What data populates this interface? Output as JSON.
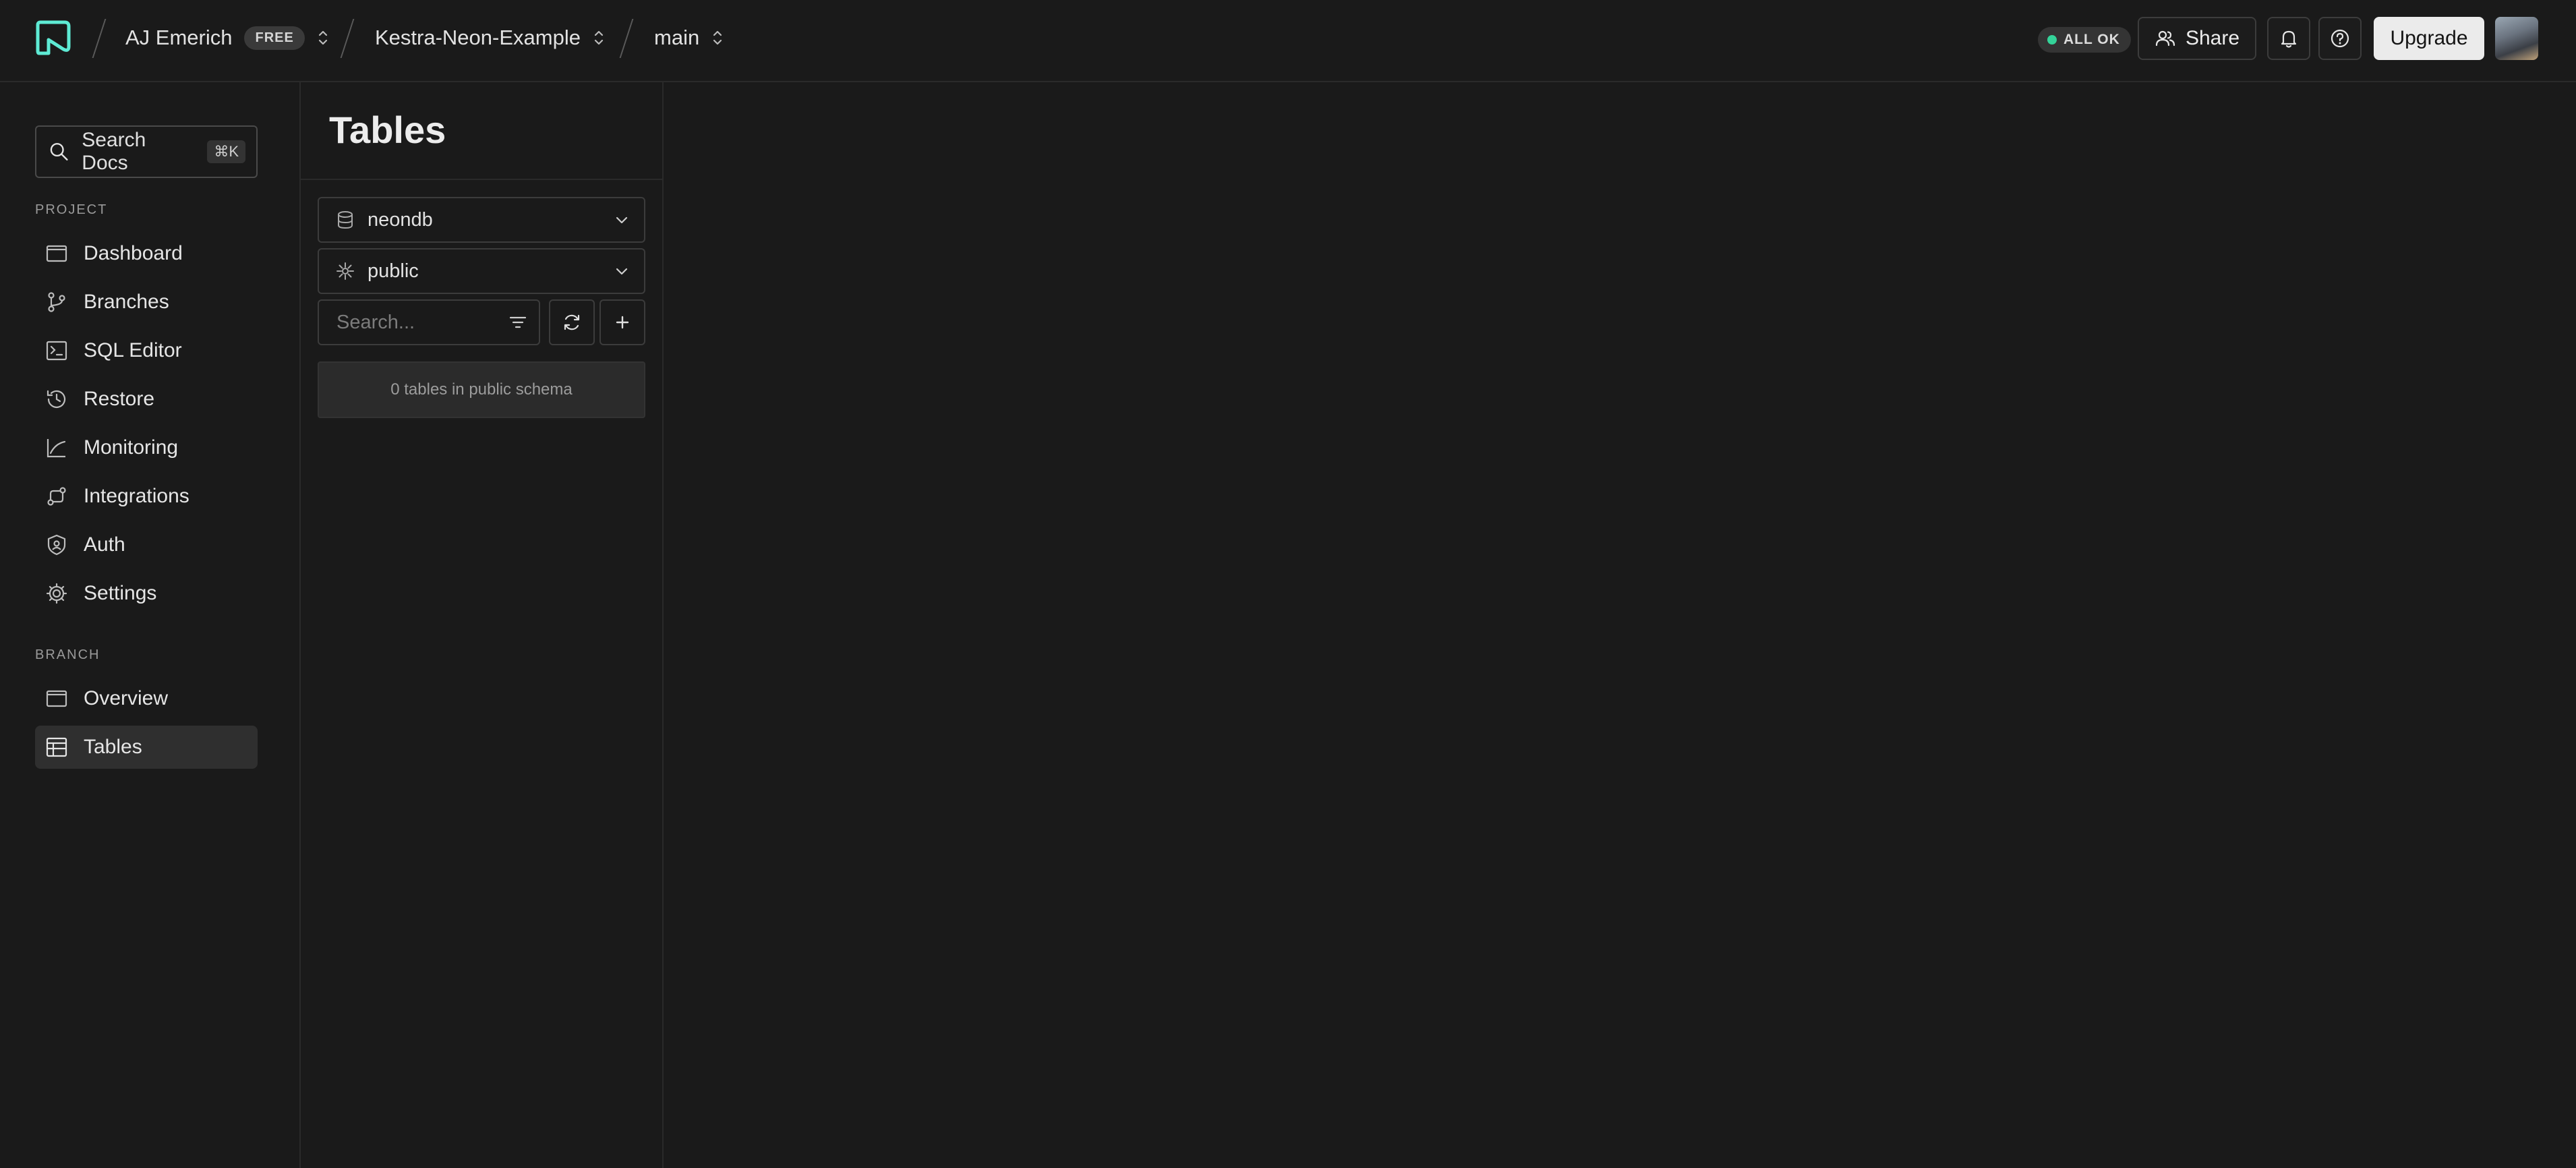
{
  "header": {
    "org_name": "AJ Emerich",
    "plan_badge": "FREE",
    "project_name": "Kestra-Neon-Example",
    "branch_name": "main",
    "status_text": "ALL OK",
    "share_label": "Share",
    "upgrade_label": "Upgrade",
    "status_color": "#34d399",
    "logo_color": "#5eead4"
  },
  "sidebar": {
    "search_label": "Search Docs",
    "search_shortcut": "⌘K",
    "project_section": "PROJECT",
    "project_items": [
      {
        "label": "Dashboard",
        "icon": "dashboard-icon"
      },
      {
        "label": "Branches",
        "icon": "branches-icon"
      },
      {
        "label": "SQL Editor",
        "icon": "sql-editor-icon"
      },
      {
        "label": "Restore",
        "icon": "restore-icon"
      },
      {
        "label": "Monitoring",
        "icon": "monitoring-icon"
      },
      {
        "label": "Integrations",
        "icon": "integrations-icon"
      },
      {
        "label": "Auth",
        "icon": "auth-icon"
      },
      {
        "label": "Settings",
        "icon": "settings-icon"
      }
    ],
    "branch_section": "BRANCH",
    "branch_items": [
      {
        "label": "Overview",
        "icon": "overview-icon"
      },
      {
        "label": "Tables",
        "icon": "tables-icon",
        "active": true
      }
    ]
  },
  "tables_panel": {
    "title": "Tables",
    "database_select": "neondb",
    "schema_select": "public",
    "search_placeholder": "Search...",
    "empty_message": "0 tables in public schema"
  }
}
